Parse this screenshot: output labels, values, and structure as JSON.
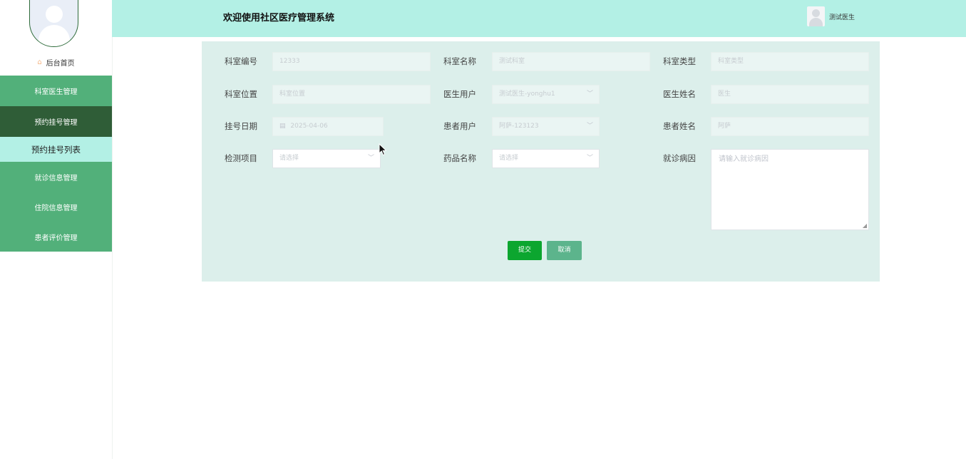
{
  "sidebar": {
    "home_label": "后台首页",
    "menu": [
      {
        "label": "科室医生管理"
      },
      {
        "label": "预约挂号管理"
      },
      {
        "label": "预约挂号列表"
      },
      {
        "label": "就诊信息管理"
      },
      {
        "label": "住院信息管理"
      },
      {
        "label": "患者评价管理"
      }
    ]
  },
  "header": {
    "title": "欢迎使用社区医疗管理系统",
    "user_name": "测试医生"
  },
  "form": {
    "dept_no": {
      "label": "科室编号",
      "value": "12333"
    },
    "dept_name": {
      "label": "科室名称",
      "value": "测试科室"
    },
    "dept_type": {
      "label": "科室类型",
      "placeholder": "科室类型"
    },
    "dept_location": {
      "label": "科室位置",
      "placeholder": "科室位置"
    },
    "doctor_user": {
      "label": "医生用户",
      "value": "测试医生-yonghu1"
    },
    "doctor_name": {
      "label": "医生姓名",
      "value": "医生"
    },
    "reg_date": {
      "label": "挂号日期",
      "value": "2025-04-06"
    },
    "patient_user": {
      "label": "患者用户",
      "value": "阿萨-123123"
    },
    "patient_name": {
      "label": "患者姓名",
      "value": "阿萨"
    },
    "exam_item": {
      "label": "检测项目",
      "placeholder": "请选择"
    },
    "drug_name": {
      "label": "药品名称",
      "placeholder": "请选择"
    },
    "visit_reason": {
      "label": "就诊病因",
      "placeholder": "请输入就诊病因"
    },
    "submit_label": "提交",
    "cancel_label": "取消"
  }
}
